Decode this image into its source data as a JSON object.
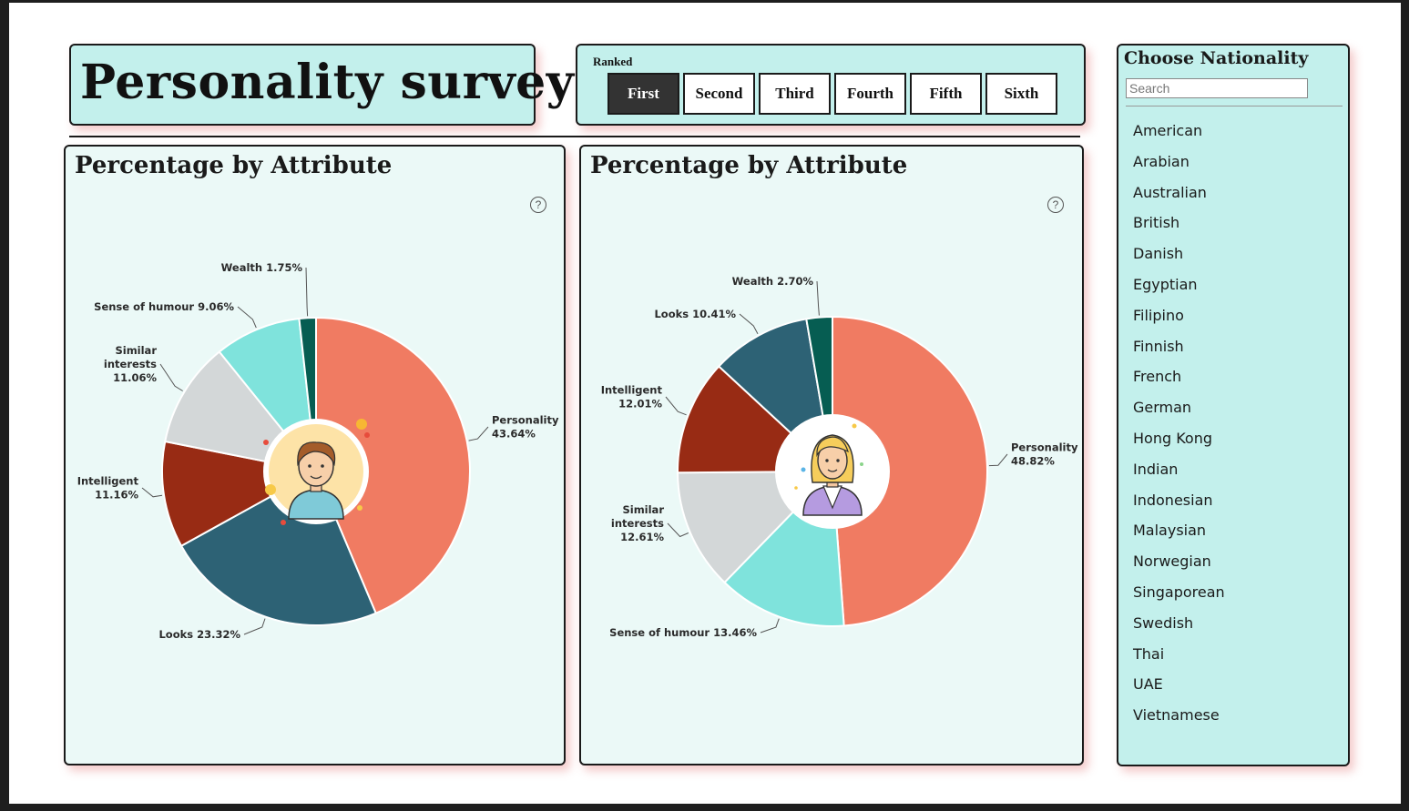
{
  "header": {
    "title": "Personality survey"
  },
  "ranked": {
    "label": "Ranked",
    "options": [
      "First",
      "Second",
      "Third",
      "Fourth",
      "Fifth",
      "Sixth"
    ],
    "selected": "First"
  },
  "nationality": {
    "title": "Choose Nationality",
    "search_placeholder": "Search",
    "options": [
      "American",
      "Arabian",
      "Australian",
      "British",
      "Danish",
      "Egyptian",
      "Filipino",
      "Finnish",
      "French",
      "German",
      "Hong Kong",
      "Indian",
      "Indonesian",
      "Malaysian",
      "Norwegian",
      "Singaporean",
      "Swedish",
      "Thai",
      "UAE",
      "Vietnamese"
    ]
  },
  "colors": {
    "Personality": "#f07b62",
    "Looks": "#2d6275",
    "Intelligent": "#982b14",
    "Similar interests": "#d3d7d8",
    "Sense of humour": "#7fe3dc",
    "Wealth": "#065d52"
  },
  "chart_data": [
    {
      "type": "pie",
      "title": "Percentage by Attribute",
      "center_icon": "man-avatar-icon",
      "slices": [
        {
          "label": "Personality",
          "value": 43.64,
          "display": "43.64%"
        },
        {
          "label": "Looks",
          "value": 23.32,
          "display": "23.32%"
        },
        {
          "label": "Intelligent",
          "value": 11.16,
          "display": "11.16%"
        },
        {
          "label": "Similar interests",
          "value": 11.06,
          "display": "11.06%"
        },
        {
          "label": "Sense of humour",
          "value": 9.06,
          "display": "9.06%"
        },
        {
          "label": "Wealth",
          "value": 1.75,
          "display": "1.75%"
        }
      ]
    },
    {
      "type": "pie",
      "title": "Percentage by Attribute",
      "center_icon": "woman-avatar-icon",
      "slices": [
        {
          "label": "Personality",
          "value": 48.82,
          "display": "48.82%"
        },
        {
          "label": "Sense of humour",
          "value": 13.46,
          "display": "13.46%"
        },
        {
          "label": "Similar interests",
          "value": 12.61,
          "display": "12.61%"
        },
        {
          "label": "Intelligent",
          "value": 12.01,
          "display": "12.01%"
        },
        {
          "label": "Looks",
          "value": 10.41,
          "display": "10.41%"
        },
        {
          "label": "Wealth",
          "value": 2.7,
          "display": "2.70%"
        }
      ]
    }
  ]
}
